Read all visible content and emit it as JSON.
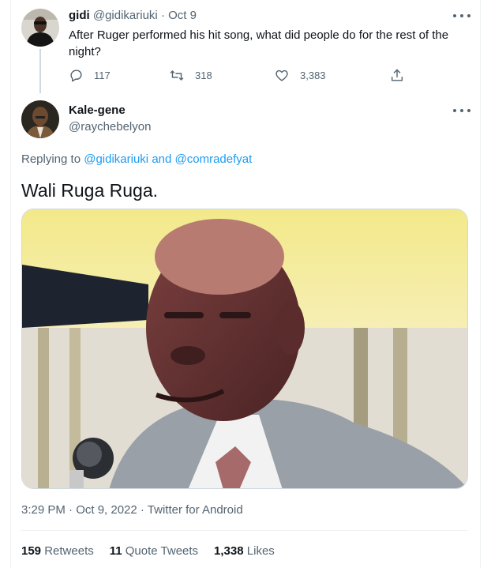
{
  "tweet1": {
    "name": "gidi",
    "handle": "@gidikariuki",
    "sep": "·",
    "date": "Oct 9",
    "text": "After Ruger performed his hit song, what did people do for the rest of the night?",
    "actions": {
      "reply_count": "117",
      "retweet_count": "318",
      "like_count": "3,383"
    }
  },
  "tweet2": {
    "name": "Kale-gene",
    "handle": "@raychebelyon",
    "replying_prefix": "Replying to",
    "replying_user1": "@gidikariuki",
    "replying_and": "and",
    "replying_user2": "@comradefyat",
    "text": "Wali Ruga Ruga.",
    "meta": "3:29 PM · Oct 9, 2022 · Twitter for Android",
    "stats": {
      "retweets_count": "159",
      "retweets_label": "Retweets",
      "quotes_count": "11",
      "quotes_label": "Quote Tweets",
      "likes_count": "1,338",
      "likes_label": "Likes"
    }
  },
  "colors": {
    "link": "#1d9bf0",
    "muted": "#536471",
    "text": "#0f1419",
    "divider": "#eff3f4"
  },
  "icons": [
    "reply-icon",
    "retweet-icon",
    "like-icon",
    "share-icon",
    "more-icon"
  ]
}
